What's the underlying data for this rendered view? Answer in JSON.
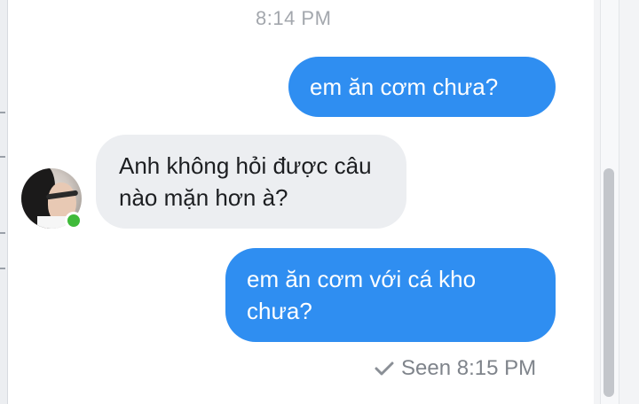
{
  "conversation": {
    "timestamp": "8:14 PM",
    "messages": [
      {
        "direction": "outgoing",
        "text": "em ăn cơm chưa?"
      },
      {
        "direction": "incoming",
        "text": "Anh không hỏi được câu nào mặn hơn à?"
      },
      {
        "direction": "outgoing",
        "text": "em ăn cơm với cá kho chưa?"
      }
    ],
    "seen_status": "Seen 8:15 PM"
  },
  "icons": {
    "seen": "check-icon",
    "contact": "avatar",
    "presence": "online-dot"
  },
  "colors": {
    "outgoing_bubble": "#2f8ef1",
    "incoming_bubble": "#eceef1",
    "online": "#3fba3a"
  }
}
